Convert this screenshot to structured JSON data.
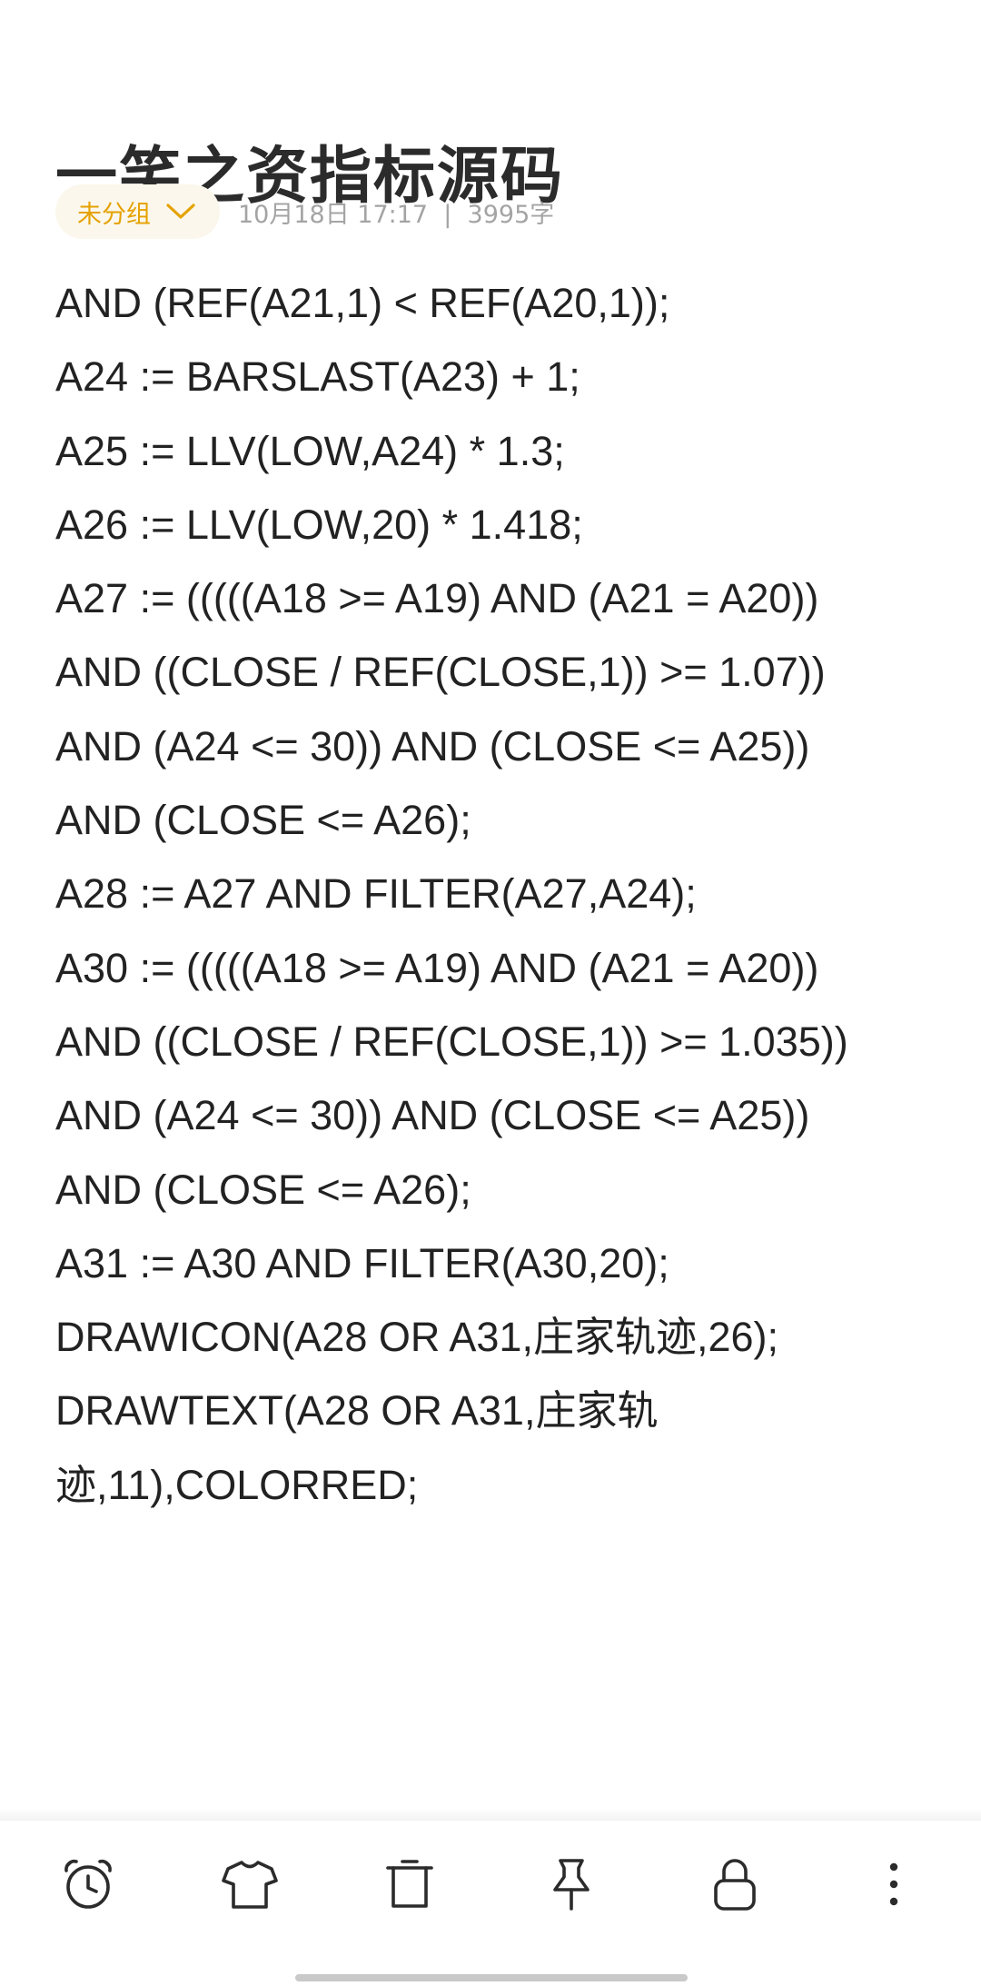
{
  "note": {
    "title": "一笑之资指标源码",
    "group_label": "未分组",
    "meta": "10月18日 17:17  |  3995字",
    "lines": [
      "AND (REF(A21,1) < REF(A20,1));",
      "A24 := BARSLAST(A23) + 1;",
      "A25 := LLV(LOW,A24) * 1.3;",
      "A26 := LLV(LOW,20) * 1.418;",
      "A27 := (((((A18 >= A19) AND (A21 = A20))",
      "AND ((CLOSE / REF(CLOSE,1)) >= 1.07))",
      "AND (A24 <= 30)) AND (CLOSE <= A25))",
      "AND (CLOSE <= A26);",
      "A28 := A27 AND FILTER(A27,A24);",
      "A30 := (((((A18 >= A19) AND (A21 = A20))",
      "AND ((CLOSE / REF(CLOSE,1)) >= 1.035))",
      "AND (A24 <= 30)) AND (CLOSE <= A25))",
      "AND (CLOSE <= A26);",
      "A31 := A30 AND FILTER(A30,20);",
      "DRAWICON(A28 OR A31,庄家轨迹,26);",
      "DRAWTEXT(A28 OR A31,庄家轨",
      "迹,11),COLORRED;"
    ]
  },
  "toolbar": {
    "icons": [
      "alarm-clock-icon",
      "shirt-icon",
      "trash-icon",
      "pin-icon",
      "lock-icon",
      "more-vertical-icon"
    ]
  },
  "colors": {
    "accent": "#e5a200",
    "chip_bg": "#fbf7ec",
    "meta_text": "#a4a4a4",
    "body_text": "#222222",
    "icon": "#2b2b2b"
  }
}
